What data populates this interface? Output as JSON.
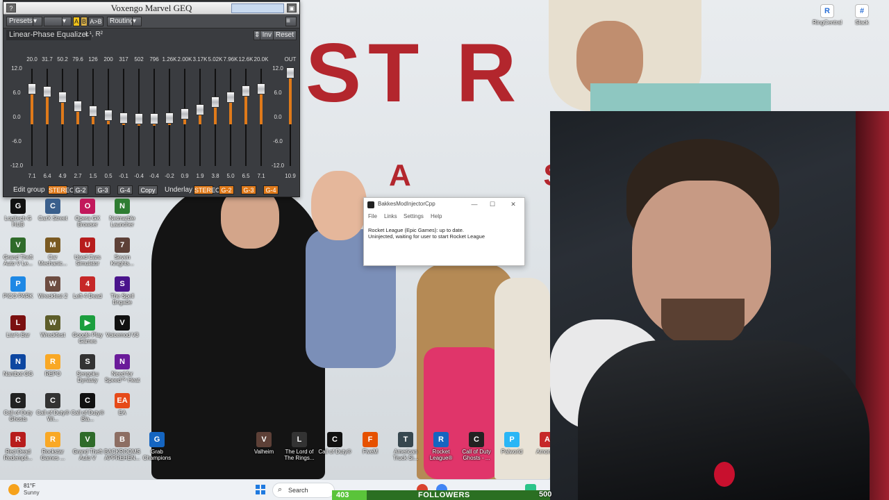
{
  "eq": {
    "title": "Voxengo Marvel GEQ",
    "help_label": "?",
    "toolbar": {
      "presets": "Presets",
      "a": "A",
      "b": "B",
      "ab": "A>B",
      "routing": "Routing"
    },
    "mode": "Linear-Phase Equalizer",
    "channel": "L¹, R²",
    "inv": "Inv",
    "reset": "Reset",
    "out_label": "OUT",
    "scale": [
      "12.0",
      "6.0",
      "0.0",
      "-6.0",
      "-12.0"
    ],
    "scale_right": [
      "12.0",
      "6.0",
      "0.0",
      "-6.0",
      "-12.0"
    ],
    "bands": [
      {
        "freq": "20.0",
        "gain": 7.1,
        "gain_text": "7.1"
      },
      {
        "freq": "31.7",
        "gain": 6.4,
        "gain_text": "6.4"
      },
      {
        "freq": "50.2",
        "gain": 4.9,
        "gain_text": "4.9"
      },
      {
        "freq": "79.6",
        "gain": 2.7,
        "gain_text": "2.7"
      },
      {
        "freq": "126",
        "gain": 1.5,
        "gain_text": "1.5"
      },
      {
        "freq": "200",
        "gain": 0.5,
        "gain_text": "0.5"
      },
      {
        "freq": "317",
        "gain": -0.1,
        "gain_text": "-0.1"
      },
      {
        "freq": "502",
        "gain": -0.4,
        "gain_text": "-0.4"
      },
      {
        "freq": "796",
        "gain": -0.4,
        "gain_text": "-0.4"
      },
      {
        "freq": "1.26K",
        "gain": -0.2,
        "gain_text": "-0.2"
      },
      {
        "freq": "2.00K",
        "gain": 0.9,
        "gain_text": "0.9"
      },
      {
        "freq": "3.17K",
        "gain": 1.9,
        "gain_text": "1.9"
      },
      {
        "freq": "5.02K",
        "gain": 3.8,
        "gain_text": "3.8"
      },
      {
        "freq": "7.96K",
        "gain": 5.0,
        "gain_text": "5.0"
      },
      {
        "freq": "12.6K",
        "gain": 6.5,
        "gain_text": "6.5"
      },
      {
        "freq": "20.0K",
        "gain": 7.1,
        "gain_text": "7.1"
      }
    ],
    "out": {
      "gain": 10.9,
      "gain_text": "10.9"
    },
    "footer": {
      "edit_group": "Edit group",
      "stereo": "STEREO",
      "g2": "G-2",
      "g3": "G-3",
      "g4": "G-4",
      "copy": "Copy",
      "underlay": "Underlay",
      "u_stereo": "STEREO",
      "u_g2": "G-2",
      "u_g3": "G-3",
      "u_g4": "G-4"
    },
    "accent": "#e07a1a"
  },
  "desktop_icons": [
    {
      "label": "Logitech G HUB",
      "glyph": "G",
      "color": "#111111"
    },
    {
      "label": "CarX Street",
      "glyph": "C",
      "color": "#3a5f8c"
    },
    {
      "label": "Opera GX Browser",
      "glyph": "O",
      "color": "#c2185b"
    },
    {
      "label": "Netmarble Launcher",
      "glyph": "N",
      "color": "#2e7d32"
    },
    {
      "label": "Grand Theft Auto V Le...",
      "glyph": "V",
      "color": "#2f6b2a"
    },
    {
      "label": "Car Mechanic...",
      "glyph": "M",
      "color": "#7a5a22"
    },
    {
      "label": "Used Cars Simulator",
      "glyph": "U",
      "color": "#b71c1c"
    },
    {
      "label": "Seven Knights...",
      "glyph": "7",
      "color": "#5d4037"
    },
    {
      "label": "PICO PARK",
      "glyph": "P",
      "color": "#1e88e5"
    },
    {
      "label": "Wreckfest 2",
      "glyph": "W",
      "color": "#6d4c41"
    },
    {
      "label": "Left 4 Dead",
      "glyph": "4",
      "color": "#c62828"
    },
    {
      "label": "The Spell Brigade",
      "glyph": "S",
      "color": "#4a148c"
    },
    {
      "label": "Liar's Bar",
      "glyph": "L",
      "color": "#7b1010"
    },
    {
      "label": "Wreckfest",
      "glyph": "W",
      "color": "#5d5d2a"
    },
    {
      "label": "Google Play Games",
      "glyph": "▶",
      "color": "#1b9e3e"
    },
    {
      "label": "Voicemod V3",
      "glyph": "V",
      "color": "#111111"
    },
    {
      "label": "Nantbot GG",
      "glyph": "N",
      "color": "#0d47a1"
    },
    {
      "label": "REPO",
      "glyph": "R",
      "color": "#f9a825"
    },
    {
      "label": "Sengoku Dynasty",
      "glyph": "S",
      "color": "#333333"
    },
    {
      "label": "Need for Speed™ Heat",
      "glyph": "N",
      "color": "#6a1b9a"
    },
    {
      "label": "Call of Duty Ghosts",
      "glyph": "C",
      "color": "#222222"
    },
    {
      "label": "Call of Duty® Wi...",
      "glyph": "C",
      "color": "#333333"
    },
    {
      "label": "Call of Duty® Bla...",
      "glyph": "C",
      "color": "#111111"
    },
    {
      "label": "EA",
      "glyph": "EA",
      "color": "#e64a19"
    },
    {
      "label": "Red Dead Redempti...",
      "glyph": "R",
      "color": "#b71c1c"
    },
    {
      "label": "Rockstar Games ...",
      "glyph": "R",
      "color": "#f9a825"
    },
    {
      "label": "Grand Theft Auto V",
      "glyph": "V",
      "color": "#2f6b2a"
    },
    {
      "label": "BACKROOMS APPREHEN...",
      "glyph": "B",
      "color": "#8d6e63"
    },
    {
      "label": "Grab Champions",
      "glyph": "G",
      "color": "#1565c0"
    }
  ],
  "bottom_icons": [
    {
      "label": "Valheim",
      "glyph": "V",
      "color": "#5d4037"
    },
    {
      "label": "The Lord of The Rings...",
      "glyph": "L",
      "color": "#333333"
    },
    {
      "label": "Call of Duty®",
      "glyph": "C",
      "color": "#111111"
    },
    {
      "label": "FiveM",
      "glyph": "F",
      "color": "#e65100"
    },
    {
      "label": "American Truck Si...",
      "glyph": "T",
      "color": "#37474f"
    },
    {
      "label": "Rocket League®",
      "glyph": "R",
      "color": "#1565c0"
    },
    {
      "label": "Call of Duty Ghosts - ...",
      "glyph": "C",
      "color": "#222222"
    },
    {
      "label": "Palworld",
      "glyph": "P",
      "color": "#29b6f6"
    },
    {
      "label": "Among...",
      "glyph": "A",
      "color": "#c62828"
    }
  ],
  "top_apps": [
    {
      "label": "RingCentral",
      "glyph": "R"
    },
    {
      "label": "Slack",
      "glyph": "#"
    }
  ],
  "bakkes": {
    "title": "BakkesModInjectorCpp",
    "menu": [
      "File",
      "Links",
      "Settings",
      "Help"
    ],
    "line1": "Rocket League (Epic Games): up to date.",
    "line2": "Uninjected, waiting for user to start Rocket League"
  },
  "wallpaper": {
    "sign_text": "ST R",
    "sign_sub": "A S"
  },
  "taskbar": {
    "temp": "81°F",
    "weather": "Sunny",
    "search": "Search"
  },
  "followers": {
    "count": "403",
    "label": "FOLLOWERS",
    "goal": "500",
    "progress": 0.16
  }
}
